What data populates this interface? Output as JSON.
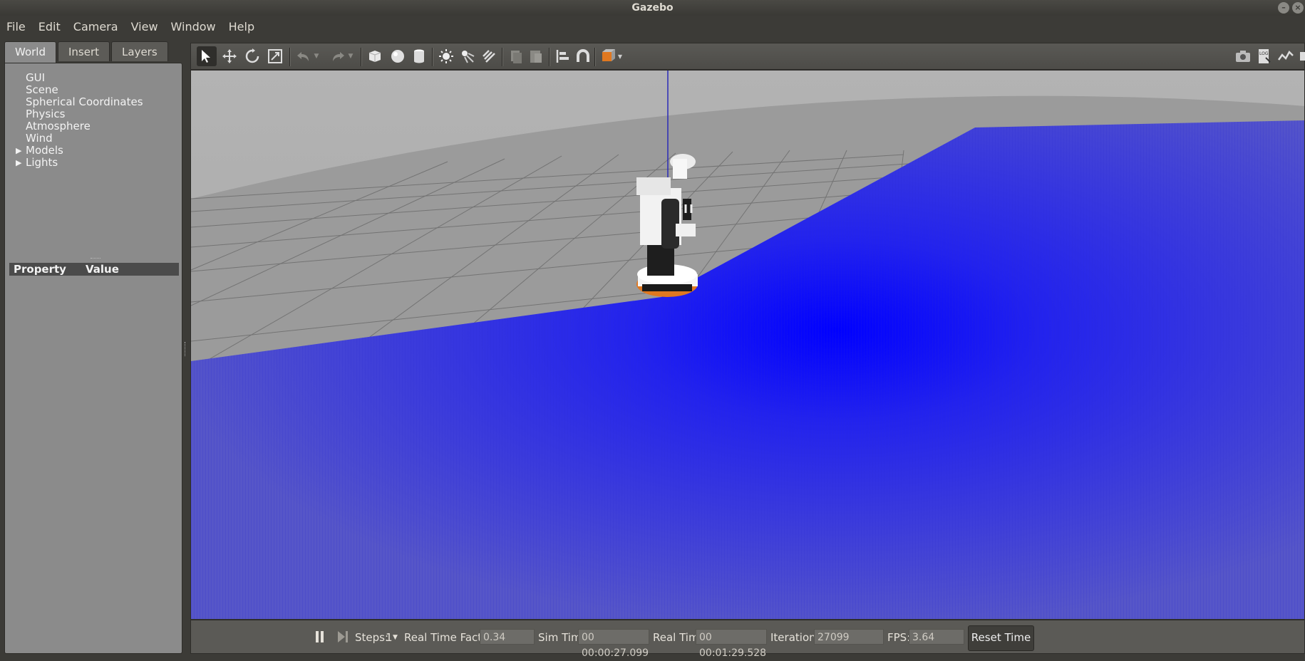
{
  "window": {
    "title": "Gazebo"
  },
  "menubar": {
    "items": [
      {
        "label": "File"
      },
      {
        "label": "Edit"
      },
      {
        "label": "Camera"
      },
      {
        "label": "View"
      },
      {
        "label": "Window"
      },
      {
        "label": "Help"
      }
    ]
  },
  "left_panel": {
    "tabs": [
      {
        "label": "World",
        "active": true
      },
      {
        "label": "Insert",
        "active": false
      },
      {
        "label": "Layers",
        "active": false
      }
    ],
    "tree": [
      {
        "label": "GUI",
        "expandable": false
      },
      {
        "label": "Scene",
        "expandable": false
      },
      {
        "label": "Spherical Coordinates",
        "expandable": false
      },
      {
        "label": "Physics",
        "expandable": false
      },
      {
        "label": "Atmosphere",
        "expandable": false
      },
      {
        "label": "Wind",
        "expandable": false
      },
      {
        "label": "Models",
        "expandable": true
      },
      {
        "label": "Lights",
        "expandable": true
      }
    ],
    "property_header": {
      "property": "Property",
      "value": "Value"
    }
  },
  "toolbar": {
    "tools": [
      "select-arrow-icon",
      "translate-icon",
      "rotate-icon",
      "scale-icon",
      "undo-icon",
      "redo-icon",
      "box-icon",
      "sphere-icon",
      "cylinder-icon",
      "point-light-icon",
      "spot-light-icon",
      "directional-light-icon",
      "copy-icon",
      "paste-icon",
      "align-icon",
      "snap-magnet-icon",
      "change-view-icon"
    ],
    "right_tools": [
      "screenshot-icon",
      "log-icon",
      "plot-icon",
      "record-video-icon"
    ]
  },
  "bottom_bar": {
    "steps_label": "Steps:",
    "steps_value": "1",
    "rtf_label": "Real Time Factor:",
    "rtf_value": "0.34",
    "sim_time_label": "Sim Time:",
    "sim_time_value": "00 00:00:27.099",
    "real_time_label": "Real Time:",
    "real_time_value": "00 00:01:29.528",
    "iterations_label": "Iterations:",
    "iterations_value": "27099",
    "fps_label": "FPS:",
    "fps_value": "3.64",
    "reset_label": "Reset Time"
  },
  "colors": {
    "laser": "#0000ff",
    "ground": "#9a9a9a",
    "robot_orange": "#e07820"
  }
}
